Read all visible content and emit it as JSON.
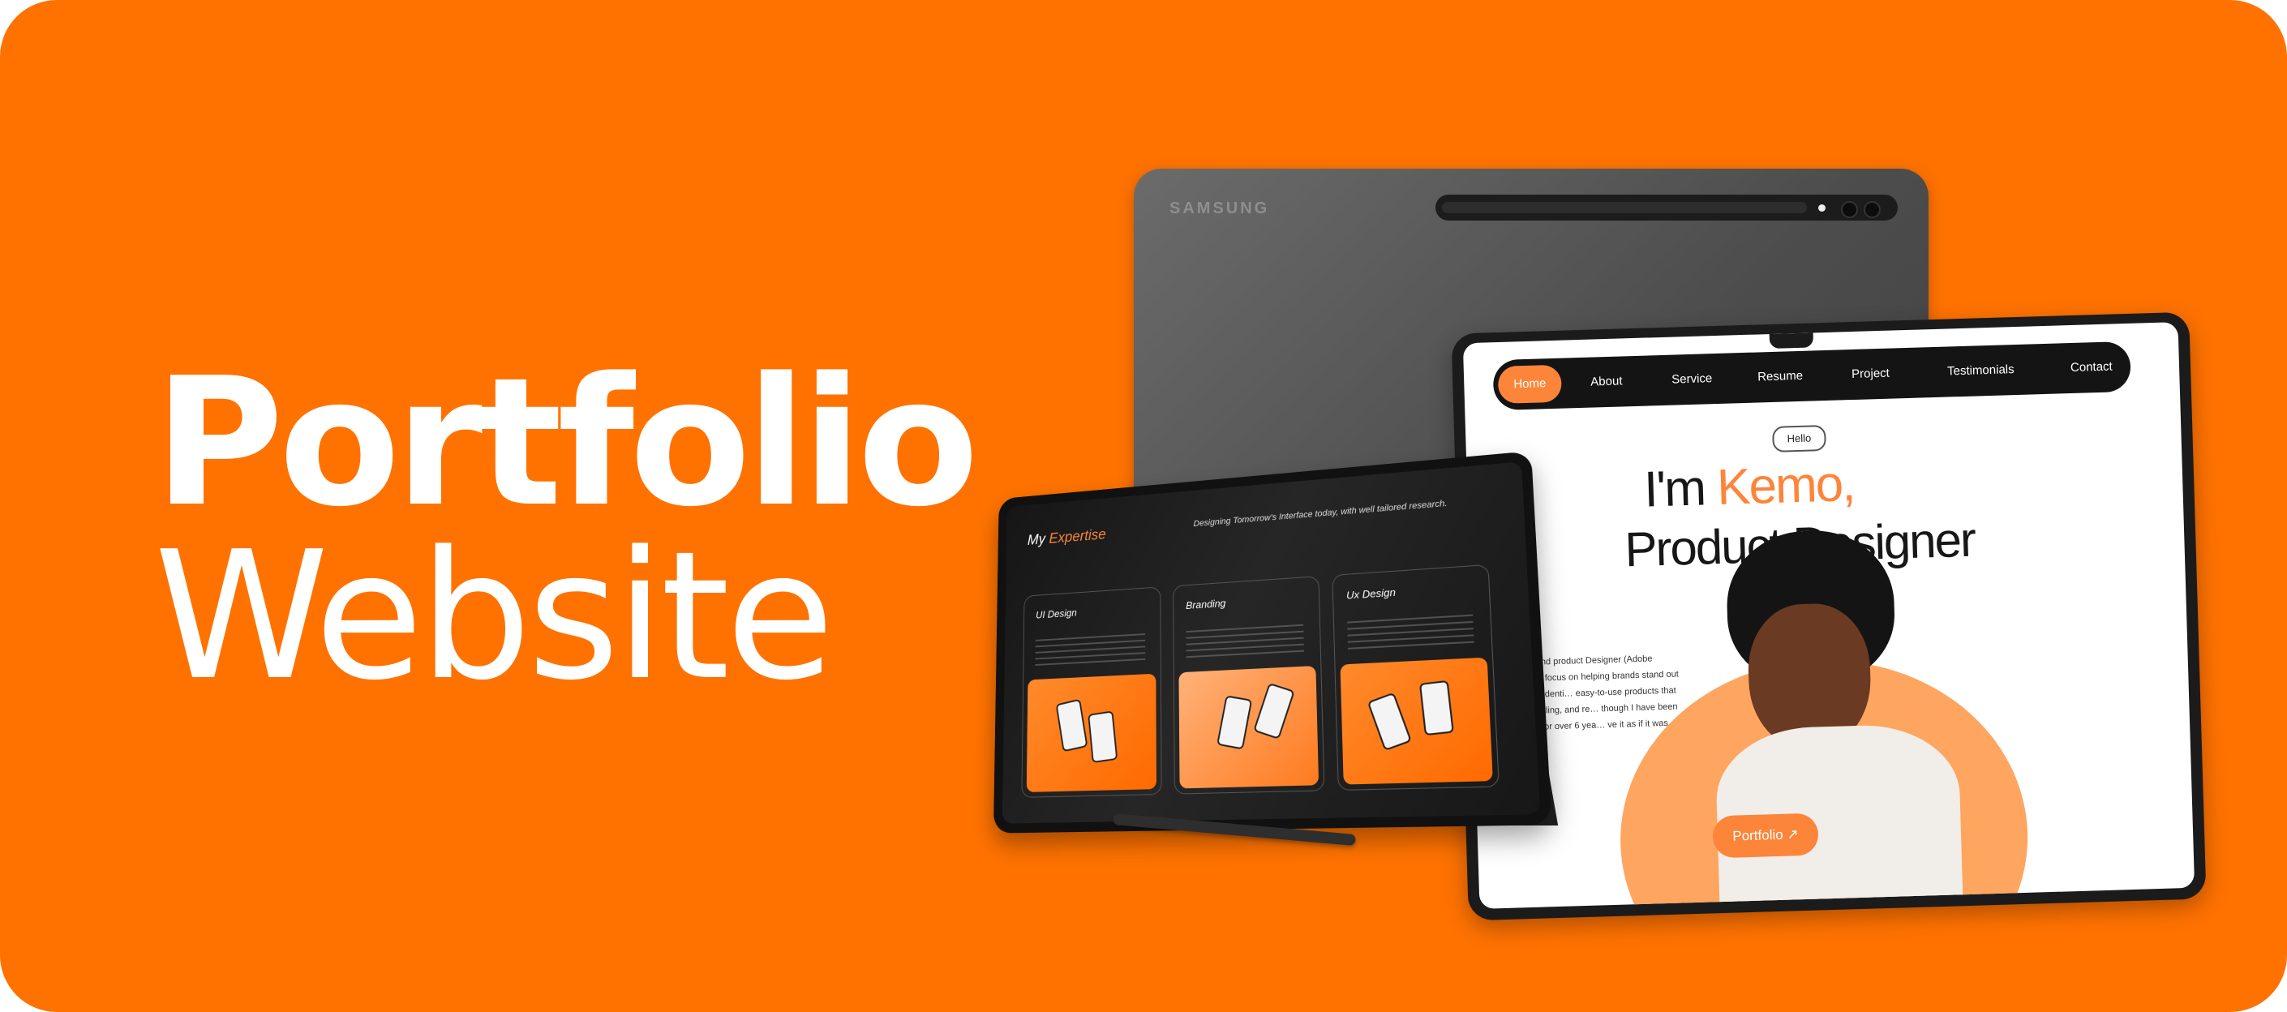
{
  "headline": {
    "line1": "Portfolio",
    "line2": "Website"
  },
  "back_tablet": {
    "brand": "SAMSUNG"
  },
  "site": {
    "nav": [
      "Home",
      "About",
      "Service",
      "Resume",
      "Project",
      "Testimonials",
      "Contact"
    ],
    "hello": "Hello",
    "hero_prefix": "I'm ",
    "hero_name": "Kemo,",
    "hero_line2": "Product Designer",
    "bio": "a brand identity and product  Designer (Adobe Illustrator & F… a focus on helping brands stand out with clear, strong identi… easy-to-use products that are visually appealing, and re… though I have been creating designs for over 6 yea… ve it as if it was something new.",
    "portfolio_button": "Portfolio ↗"
  },
  "expertise": {
    "title_prefix": "My ",
    "title_accent": "Expertise",
    "subtitle": "Designing Tomorrow's Interface today, with well tailored research.",
    "cards": [
      {
        "title": "UI Design"
      },
      {
        "title": "Branding"
      },
      {
        "title": "Ux Design"
      }
    ]
  },
  "colors": {
    "background": "#ff7200",
    "accent": "#fd853a",
    "dark": "#141414"
  }
}
